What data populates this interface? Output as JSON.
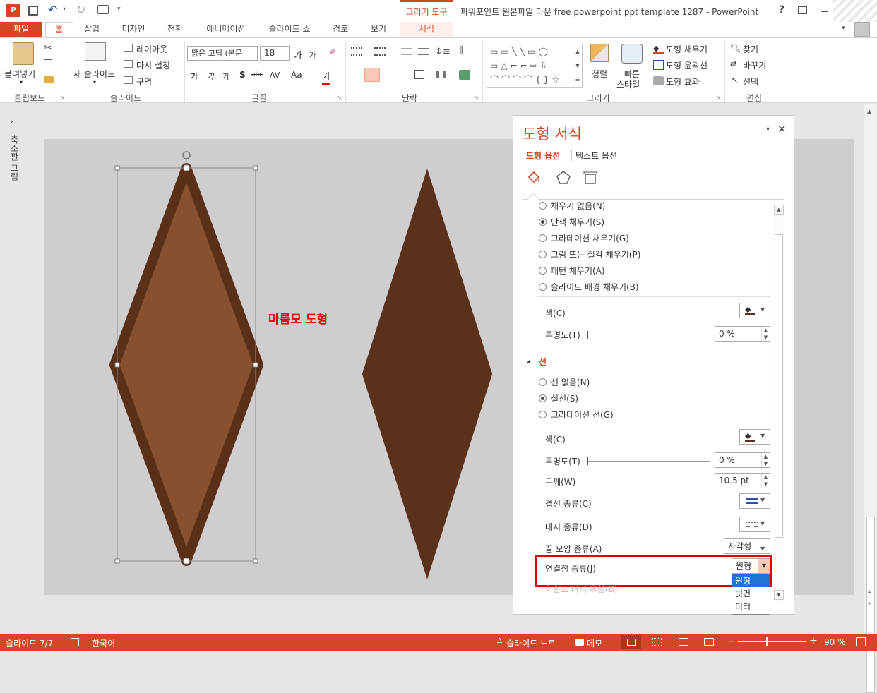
{
  "window": {
    "title": "파워포인트 원본파일 다운 free powerpoint ppt template 1287 - PowerPoint",
    "context_group": "그리기 도구",
    "help": "?"
  },
  "tabs": [
    "파일",
    "홈",
    "삽입",
    "디자인",
    "전환",
    "애니메이션",
    "슬라이드 쇼",
    "검토",
    "보기",
    "서식"
  ],
  "ribbon": {
    "clipboard": {
      "paste": "붙여넣기",
      "label": "클립보드"
    },
    "slides": {
      "new_slide": "새 슬라이드",
      "layout": "레이아웃",
      "reset": "다시 설정",
      "section": "구역",
      "label": "슬라이드"
    },
    "font": {
      "name": "맑은 고딕 (본문",
      "size": "18",
      "label": "글꼴",
      "b": "가",
      "i": "가",
      "u": "가",
      "s": "S",
      "strike": "abc",
      "spacing": "AV",
      "case": "Aa",
      "color": "가",
      "grow": "가",
      "shrink": "가"
    },
    "paragraph": {
      "label": "단락"
    },
    "drawing": {
      "arrange": "정렬",
      "quick_styles": "빠른",
      "quick_styles2": "스타일",
      "fill": "도형 채우기",
      "outline": "도형 윤곽선",
      "effects": "도형 효과",
      "label": "그리기"
    },
    "editing": {
      "find": "찾기",
      "replace": "바꾸기",
      "select": "선택",
      "label": "편집"
    }
  },
  "left_strip": {
    "label": "축소판 그림"
  },
  "slide": {
    "annotation": "마름모 도형"
  },
  "pane": {
    "title": "도형 서식",
    "tab_shape": "도형 옵션",
    "tab_text": "텍스트 옵션",
    "fill_options": [
      {
        "label": "채우기 없음(N)",
        "selected": false
      },
      {
        "label": "단색 채우기(S)",
        "selected": true
      },
      {
        "label": "그라데이션 채우기(G)",
        "selected": false
      },
      {
        "label": "그림 또는 질감 채우기(P)",
        "selected": false
      },
      {
        "label": "패턴 채우기(A)",
        "selected": false
      },
      {
        "label": "슬라이드 배경 채우기(B)",
        "selected": false
      }
    ],
    "fill_color_label": "색(C)",
    "fill_transparency_label": "투명도(T)",
    "fill_transparency": "0 %",
    "line_section": "선",
    "line_options": [
      {
        "label": "선 없음(N)",
        "selected": false
      },
      {
        "label": "실선(S)",
        "selected": true
      },
      {
        "label": "그라데이션 선(G)",
        "selected": false
      }
    ],
    "line_color_label": "색(C)",
    "line_transparency_label": "투명도(T)",
    "line_transparency": "0 %",
    "width_label": "두께(W)",
    "width": "10.5 pt",
    "compound_label": "겹선 종류(C)",
    "dash_label": "대시 종류(D)",
    "cap_label": "끝 모양 종류(A)",
    "cap_value": "사각형",
    "join_label": "연결점 종류(J)",
    "join_value": "원형",
    "begin_arrow_label": "화살표 머리 유형(B)",
    "join_options": [
      "원형",
      "빗면",
      "미터"
    ]
  },
  "status": {
    "slide": "슬라이드 7/7",
    "language": "한국어",
    "notes": "슬라이드 노트",
    "comments": "메모",
    "zoom": "90 %"
  },
  "colors": {
    "accent": "#d24726",
    "diamond_outer": "#5b3019",
    "diamond_inner": "#87502e",
    "diamond2": "#5a321b",
    "highlight": "#e00000"
  }
}
